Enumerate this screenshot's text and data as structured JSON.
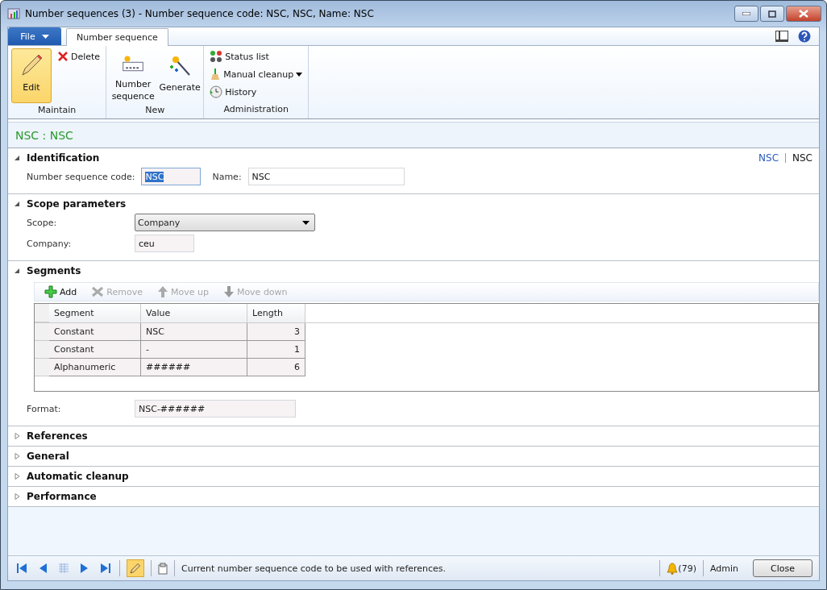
{
  "window": {
    "title": "Number sequences (3) - Number sequence code: NSC, NSC, Name: NSC"
  },
  "ribbon_tabs": [
    {
      "label": "File",
      "kind": "file",
      "selected": false
    },
    {
      "label": "Number sequence",
      "kind": "tab",
      "selected": true
    }
  ],
  "ribbon_groups": [
    {
      "label": "Maintain",
      "buttons": [
        {
          "label": "Edit",
          "kind": "large",
          "selected": true
        },
        {
          "label": "Delete",
          "kind": "small",
          "selected": false
        }
      ]
    },
    {
      "label": "New",
      "buttons": [
        {
          "label": "Number sequence",
          "kind": "large",
          "selected": false
        },
        {
          "label": "Generate",
          "kind": "large",
          "selected": false
        }
      ]
    },
    {
      "label": "Administration",
      "buttons": [
        {
          "label": "Status list",
          "kind": "small",
          "selected": false
        },
        {
          "label": "Manual cleanup",
          "kind": "small",
          "selected": false,
          "dropdown": true
        },
        {
          "label": "History",
          "kind": "small",
          "selected": false
        }
      ]
    }
  ],
  "form_header": "NSC : NSC",
  "sections": [
    {
      "title": "Identification",
      "kind": "inline_fields",
      "expanded": true,
      "links": [
        {
          "label": "NSC",
          "selected": false
        },
        {
          "label": "NSC",
          "selected": true
        }
      ],
      "fields": [
        {
          "label": "Number sequence code:",
          "value": "NSC",
          "kind": "text",
          "highlighted": true
        },
        {
          "label": "Name:",
          "value": "NSC",
          "kind": "text",
          "highlighted": false
        }
      ]
    },
    {
      "title": "Scope parameters",
      "kind": "fields",
      "expanded": true,
      "fields": [
        {
          "label": "Scope:",
          "value": "Company",
          "kind": "dropdown"
        },
        {
          "label": "Company:",
          "value": "ceu",
          "kind": "text",
          "highlighted": false
        }
      ]
    },
    {
      "title": "Segments",
      "kind": "grid",
      "expanded": true,
      "toolbar": [
        {
          "label": "Add",
          "disabled": false
        },
        {
          "label": "Remove",
          "disabled": true
        },
        {
          "label": "Move up",
          "disabled": true
        },
        {
          "label": "Move down",
          "disabled": true
        }
      ],
      "columns": [
        "Segment",
        "Value",
        "Length"
      ],
      "rows": [
        [
          "Constant",
          "NSC",
          "3"
        ],
        [
          "Constant",
          "-",
          "1"
        ],
        [
          "Alphanumeric",
          "######",
          "6"
        ]
      ],
      "format": {
        "label": "Format:",
        "value": "NSC-######"
      }
    },
    {
      "title": "References",
      "expanded": false
    },
    {
      "title": "General",
      "expanded": false
    },
    {
      "title": "Automatic cleanup",
      "expanded": false
    },
    {
      "title": "Performance",
      "expanded": false
    }
  ],
  "status_bar": {
    "edit_active": true,
    "message": "Current number sequence code to be used with references.",
    "notifications": "(79)",
    "user": "Admin",
    "button": "Close"
  }
}
